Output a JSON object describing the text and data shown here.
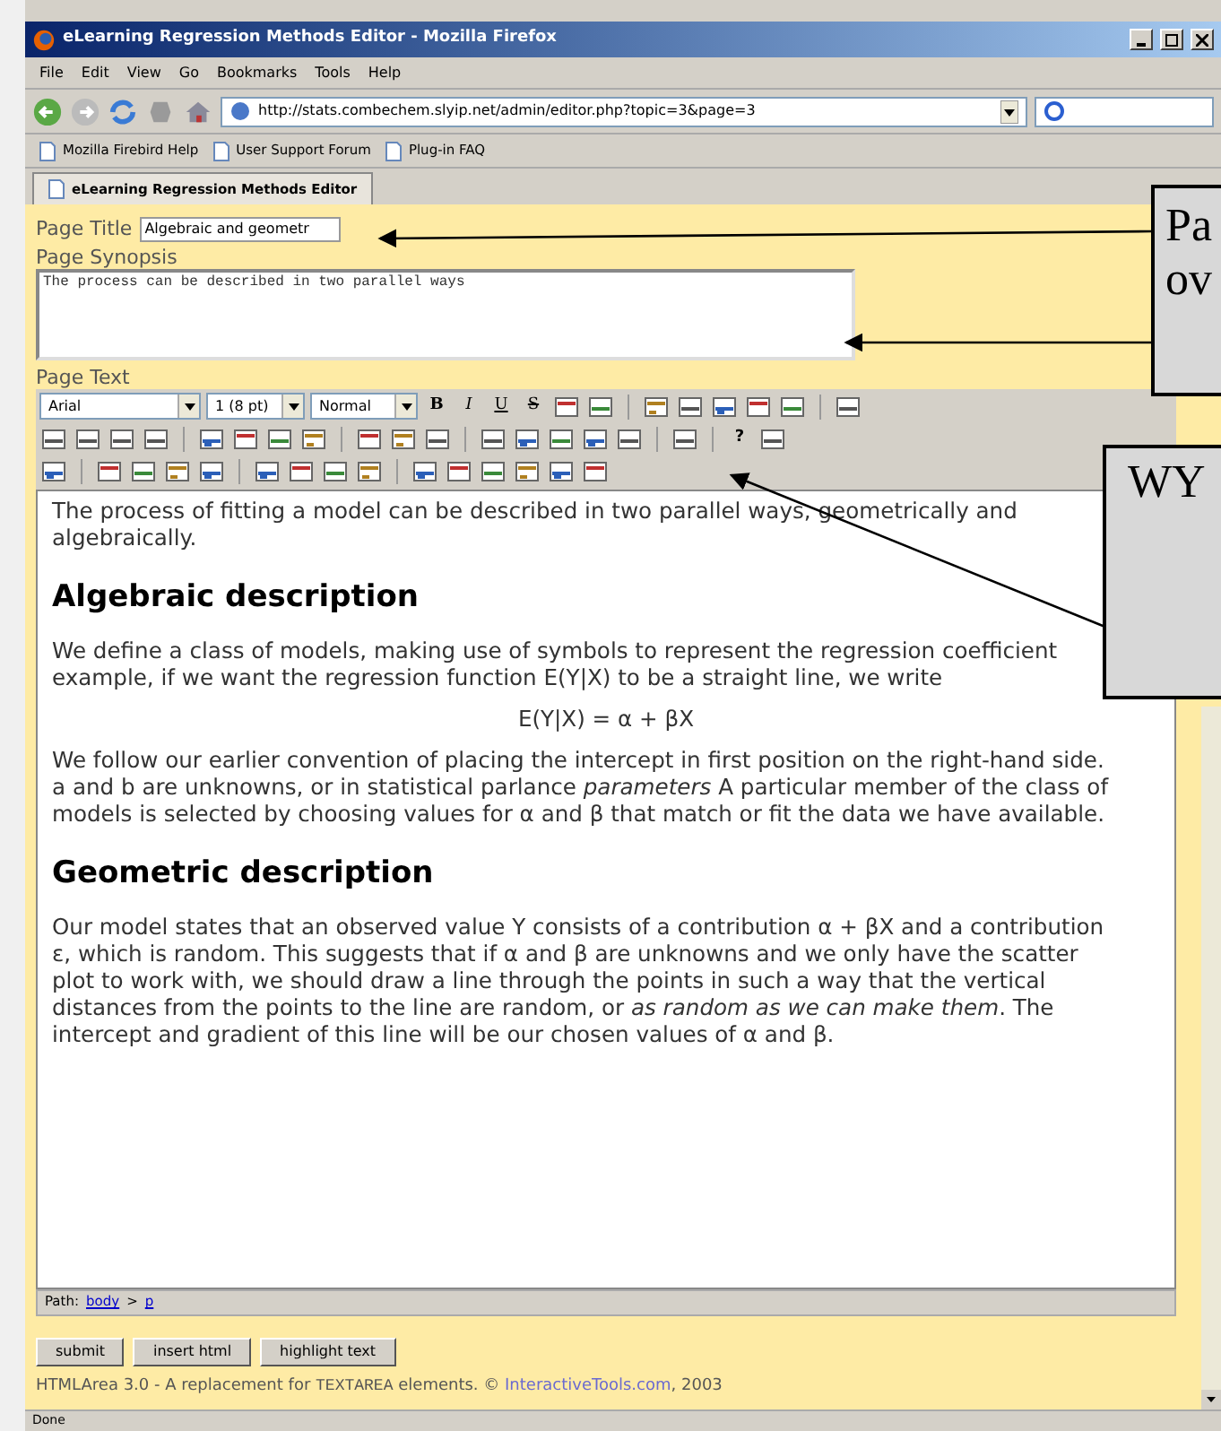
{
  "window": {
    "title": "eLearning Regression Methods Editor - Mozilla Firefox"
  },
  "menu": [
    "File",
    "Edit",
    "View",
    "Go",
    "Bookmarks",
    "Tools",
    "Help"
  ],
  "address": {
    "value": "http://stats.combechem.slyip.net/admin/editor.php?topic=3&page=3"
  },
  "bookmarks": [
    "Mozilla Firebird Help",
    "User Support Forum",
    "Plug-in FAQ"
  ],
  "tabs": [
    {
      "label": "eLearning Regression Methods Editor",
      "selected": true
    }
  ],
  "form": {
    "title_label": "Page Title",
    "title_value": "Algebraic and geometr",
    "synopsis_label": "Page Synopsis",
    "synopsis_value": "The process can be described in two parallel ways",
    "text_label": "Page Text"
  },
  "toolbar": {
    "selects": [
      "Arial",
      "1 (8 pt)",
      "Normal"
    ],
    "format_buttons": [
      "B",
      "I",
      "U",
      "S"
    ],
    "help": "?"
  },
  "editor": [
    {
      "kind": "para",
      "lines": [
        "The process of fitting a model can be described in two parallel ways, geometrically and",
        "algebraically."
      ]
    },
    {
      "kind": "heading",
      "lines": [
        "Algebraic description"
      ]
    },
    {
      "kind": "para",
      "lines": [
        "We define a class of models, making use of symbols to represent the regression coefficient",
        "example, if we want the regression function E(Y|X) to be a straight line, we write"
      ]
    },
    {
      "kind": "formula",
      "lines": [
        "E(Y|X) = α + βX"
      ]
    },
    {
      "kind": "para",
      "lines": [
        "We follow our earlier convention of placing the intercept in first position on the right-hand side.",
        "a and b are unknowns, or in statistical parlance *parameters* A particular member of the class of",
        "models is selected by choosing values for α and β that match or fit the data we have available."
      ]
    },
    {
      "kind": "heading",
      "lines": [
        "Geometric description"
      ]
    },
    {
      "kind": "para",
      "lines": [
        "Our model states that an observed value Y consists of a contribution α + βX and a contribution",
        "ε, which is random. This suggests that if α and β are unknowns and we only have the scatter",
        "plot to work with, we should draw a line through the points in such a way that the vertical",
        "distances from the points to the line are random, or *as random as we can make them*. The",
        "intercept and gradient of this line will be our chosen values of α and β."
      ]
    }
  ],
  "path": {
    "label": "Path:",
    "links": [
      "body",
      "p"
    ],
    "separator": ">"
  },
  "buttons": [
    "submit",
    "insert html",
    "highlight text"
  ],
  "footer": {
    "text": "HTMLArea 3.0 - A replacement for",
    "code": "TEXTAREA",
    "rest": "elements. ©",
    "link": "InteractiveTools.com",
    "year": ", 2003"
  },
  "status_bar": "Done",
  "callouts": [
    {
      "lines": [
        "Pa",
        "ov"
      ]
    },
    {
      "lines": [
        "WY"
      ]
    }
  ]
}
